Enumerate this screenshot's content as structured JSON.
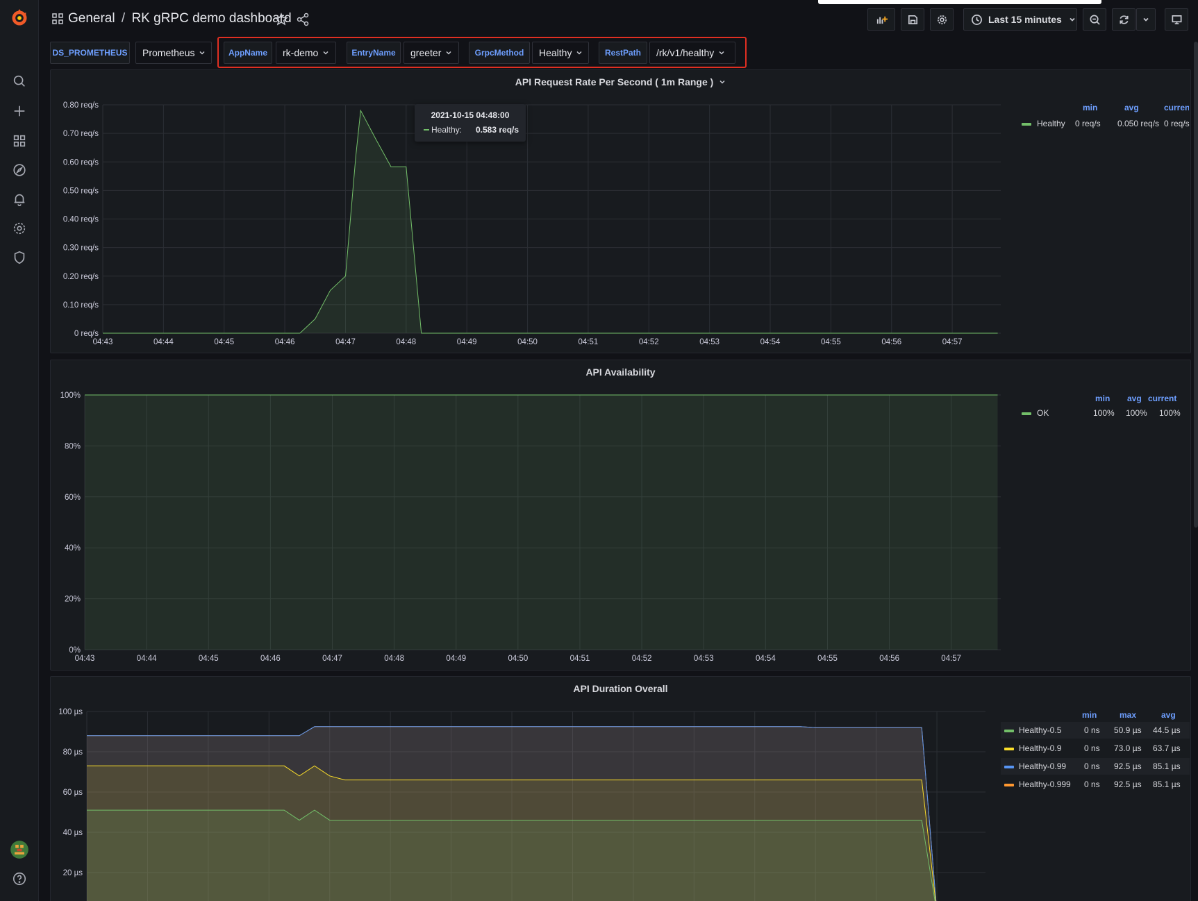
{
  "header": {
    "folder": "General",
    "separator": "/",
    "dashboard_title": "RK gRPC demo dashboard",
    "time_range": "Last 15 minutes"
  },
  "variables": [
    {
      "label": "DS_PROMETHEUS",
      "value": "Prometheus"
    },
    {
      "label": "AppName",
      "value": "rk-demo"
    },
    {
      "label": "EntryName",
      "value": "greeter"
    },
    {
      "label": "GrpcMethod",
      "value": "Healthy"
    },
    {
      "label": "RestPath",
      "value": "/rk/v1/healthy"
    }
  ],
  "sidebar": {
    "icons": [
      "grafana-logo-icon",
      "search-icon",
      "plus-icon",
      "dashboards-icon",
      "explore-icon",
      "alerting-icon",
      "configuration-icon",
      "shield-icon",
      "user-avatar",
      "help-icon"
    ]
  },
  "colors": {
    "green": "#73bf69",
    "yellow": "#fade2a",
    "orange": "#ff9830",
    "cyan": "#5794f2",
    "accent": "#6e9fff",
    "highlight": "#e02f22"
  },
  "panels": {
    "rate": {
      "title": "API Request Rate Per Second ( 1m Range )",
      "legend_headers": [
        "min",
        "avg",
        "current"
      ],
      "legend_rows": [
        {
          "name": "Healthy",
          "min": "0 req/s",
          "avg": "0.050 req/s",
          "current": "0 req/s"
        }
      ],
      "tooltip": {
        "time": "2021-10-15 04:48:00",
        "series": "Healthy:",
        "value": "0.583 req/s"
      }
    },
    "availability": {
      "title": "API Availability",
      "legend_headers": [
        "min",
        "avg",
        "current"
      ],
      "legend_rows": [
        {
          "name": "OK",
          "min": "100%",
          "avg": "100%",
          "current": "100%"
        }
      ]
    },
    "duration": {
      "title": "API Duration Overall",
      "legend_headers": [
        "min",
        "max",
        "avg"
      ],
      "legend_rows": [
        {
          "name": "Healthy-0.5",
          "min": "0 ns",
          "max": "50.9 µs",
          "avg": "44.5 µs"
        },
        {
          "name": "Healthy-0.9",
          "min": "0 ns",
          "max": "73.0 µs",
          "avg": "63.7 µs"
        },
        {
          "name": "Healthy-0.99",
          "min": "0 ns",
          "max": "92.5 µs",
          "avg": "85.1 µs"
        },
        {
          "name": "Healthy-0.999",
          "min": "0 ns",
          "max": "92.5 µs",
          "avg": "85.1 µs"
        }
      ]
    }
  },
  "chart_data": [
    {
      "type": "area",
      "title": "API Request Rate Per Second ( 1m Range )",
      "x_ticks": [
        "04:43",
        "04:44",
        "04:45",
        "04:46",
        "04:47",
        "04:48",
        "04:49",
        "04:50",
        "04:51",
        "04:52",
        "04:53",
        "04:54",
        "04:55",
        "04:56",
        "04:57"
      ],
      "y_ticks": [
        "0 req/s",
        "0.10 req/s",
        "0.20 req/s",
        "0.30 req/s",
        "0.40 req/s",
        "0.50 req/s",
        "0.60 req/s",
        "0.70 req/s",
        "0.80 req/s"
      ],
      "ylim": [
        0,
        0.8
      ],
      "xlim_minutes": [
        0,
        14.8
      ],
      "series": [
        {
          "name": "Healthy",
          "x": [
            0,
            3.25,
            3.5,
            3.75,
            4.0,
            4.17,
            4.25,
            4.5,
            4.75,
            5.0,
            5.25,
            14.75
          ],
          "y": [
            0,
            0,
            0.05,
            0.15,
            0.2,
            0.62,
            0.78,
            0.68,
            0.583,
            0.583,
            0,
            0
          ]
        }
      ]
    },
    {
      "type": "area",
      "title": "API Availability",
      "x_ticks": [
        "04:43",
        "04:44",
        "04:45",
        "04:46",
        "04:47",
        "04:48",
        "04:49",
        "04:50",
        "04:51",
        "04:52",
        "04:53",
        "04:54",
        "04:55",
        "04:56",
        "04:57"
      ],
      "y_ticks": [
        "0%",
        "20%",
        "40%",
        "60%",
        "80%",
        "100%"
      ],
      "ylim": [
        0,
        100
      ],
      "xlim_minutes": [
        0,
        14.8
      ],
      "series": [
        {
          "name": "OK",
          "x": [
            0,
            14.75
          ],
          "y": [
            100,
            100
          ]
        }
      ]
    },
    {
      "type": "area",
      "title": "API Duration Overall",
      "y_ticks": [
        "20 µs",
        "40 µs",
        "60 µs",
        "80 µs",
        "100 µs"
      ],
      "ylim": [
        0,
        100
      ],
      "xlim_minutes": [
        0,
        14.8
      ],
      "series": [
        {
          "name": "Healthy-0.999",
          "x": [
            0,
            3.5,
            3.75,
            11.75,
            12.0,
            13.75,
            14.0
          ],
          "y": [
            88,
            88,
            92.5,
            92.5,
            92,
            92,
            0
          ]
        },
        {
          "name": "Healthy-0.99",
          "x": [
            0,
            3.5,
            3.75,
            11.75,
            12.0,
            13.75,
            14.0
          ],
          "y": [
            88,
            88,
            92.5,
            92.5,
            92,
            92,
            0
          ]
        },
        {
          "name": "Healthy-0.9",
          "x": [
            0,
            3.25,
            3.5,
            3.75,
            4.0,
            4.25,
            13.75,
            14.0
          ],
          "y": [
            73,
            73,
            68,
            73,
            68,
            66,
            66,
            0
          ]
        },
        {
          "name": "Healthy-0.5",
          "x": [
            0,
            3.25,
            3.5,
            3.75,
            4.0,
            13.75,
            14.0
          ],
          "y": [
            51,
            51,
            46,
            51,
            46,
            46,
            0
          ]
        }
      ]
    }
  ]
}
